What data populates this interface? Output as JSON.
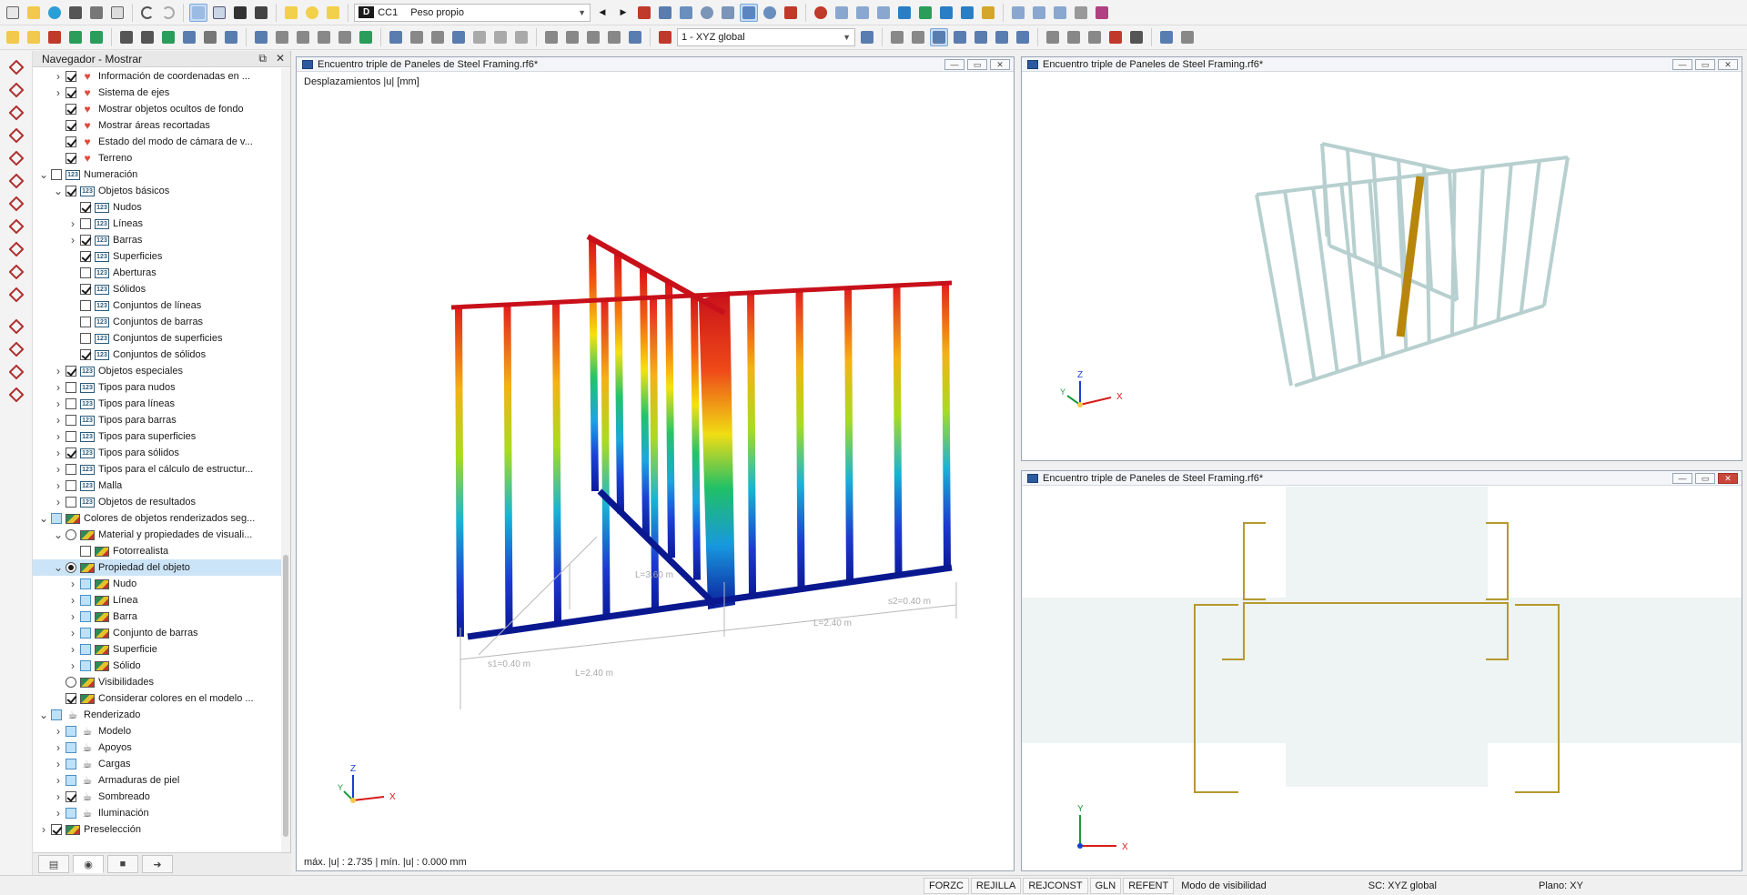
{
  "toolbar": {
    "load_case_badge": "D",
    "load_case_id": "CC1",
    "load_case_name": "Peso propio",
    "coordinate_system": "1 - XYZ global"
  },
  "navigator": {
    "title": "Navegador - Mostrar",
    "items": [
      {
        "indent": 1,
        "twisty": ">",
        "ctl": "cb",
        "checked": true,
        "icon": "heart",
        "label": "Información de coordenadas en ..."
      },
      {
        "indent": 1,
        "twisty": ">",
        "ctl": "cb",
        "checked": true,
        "icon": "heart",
        "label": "Sistema de ejes"
      },
      {
        "indent": 1,
        "twisty": "",
        "ctl": "cb",
        "checked": true,
        "icon": "heart",
        "label": "Mostrar objetos ocultos de fondo"
      },
      {
        "indent": 1,
        "twisty": "",
        "ctl": "cb",
        "checked": true,
        "icon": "heart",
        "label": "Mostrar áreas recortadas"
      },
      {
        "indent": 1,
        "twisty": "",
        "ctl": "cb",
        "checked": true,
        "icon": "heart",
        "label": "Estado del modo de cámara de v..."
      },
      {
        "indent": 1,
        "twisty": "",
        "ctl": "cb",
        "checked": true,
        "icon": "heart",
        "label": "Terreno"
      },
      {
        "indent": 0,
        "twisty": "v",
        "ctl": "cb",
        "checked": false,
        "icon": "num",
        "label": "Numeración"
      },
      {
        "indent": 1,
        "twisty": "v",
        "ctl": "cb",
        "checked": true,
        "icon": "num",
        "label": "Objetos básicos"
      },
      {
        "indent": 2,
        "twisty": "",
        "ctl": "cb",
        "checked": true,
        "icon": "num",
        "label": "Nudos"
      },
      {
        "indent": 2,
        "twisty": ">",
        "ctl": "cb",
        "checked": false,
        "icon": "num",
        "label": "Líneas"
      },
      {
        "indent": 2,
        "twisty": ">",
        "ctl": "cb",
        "checked": true,
        "icon": "num",
        "label": "Barras"
      },
      {
        "indent": 2,
        "twisty": "",
        "ctl": "cb",
        "checked": true,
        "icon": "num",
        "label": "Superficies"
      },
      {
        "indent": 2,
        "twisty": "",
        "ctl": "cb",
        "checked": false,
        "icon": "num",
        "label": "Aberturas"
      },
      {
        "indent": 2,
        "twisty": "",
        "ctl": "cb",
        "checked": true,
        "icon": "num",
        "label": "Sólidos"
      },
      {
        "indent": 2,
        "twisty": "",
        "ctl": "cb",
        "checked": false,
        "icon": "num",
        "label": "Conjuntos de líneas"
      },
      {
        "indent": 2,
        "twisty": "",
        "ctl": "cb",
        "checked": false,
        "icon": "num",
        "label": "Conjuntos de barras"
      },
      {
        "indent": 2,
        "twisty": "",
        "ctl": "cb",
        "checked": false,
        "icon": "num",
        "label": "Conjuntos de superficies"
      },
      {
        "indent": 2,
        "twisty": "",
        "ctl": "cb",
        "checked": true,
        "icon": "num",
        "label": "Conjuntos de sólidos"
      },
      {
        "indent": 1,
        "twisty": ">",
        "ctl": "cb",
        "checked": true,
        "icon": "num",
        "label": "Objetos especiales"
      },
      {
        "indent": 1,
        "twisty": ">",
        "ctl": "cb",
        "checked": false,
        "icon": "num",
        "label": "Tipos para nudos"
      },
      {
        "indent": 1,
        "twisty": ">",
        "ctl": "cb",
        "checked": false,
        "icon": "num",
        "label": "Tipos para líneas"
      },
      {
        "indent": 1,
        "twisty": ">",
        "ctl": "cb",
        "checked": false,
        "icon": "num",
        "label": "Tipos para barras"
      },
      {
        "indent": 1,
        "twisty": ">",
        "ctl": "cb",
        "checked": false,
        "icon": "num",
        "label": "Tipos para superficies"
      },
      {
        "indent": 1,
        "twisty": ">",
        "ctl": "cb",
        "checked": true,
        "icon": "num",
        "label": "Tipos para sólidos"
      },
      {
        "indent": 1,
        "twisty": ">",
        "ctl": "cb",
        "checked": false,
        "icon": "num",
        "label": "Tipos para el cálculo de estructur..."
      },
      {
        "indent": 1,
        "twisty": ">",
        "ctl": "cb",
        "checked": false,
        "icon": "num",
        "label": "Malla"
      },
      {
        "indent": 1,
        "twisty": ">",
        "ctl": "cb",
        "checked": false,
        "icon": "num",
        "label": "Objetos de resultados"
      },
      {
        "indent": 0,
        "twisty": "v",
        "ctl": "cbblue",
        "checked": false,
        "icon": "color",
        "label": "Colores de objetos renderizados seg..."
      },
      {
        "indent": 1,
        "twisty": "v",
        "ctl": "rb",
        "checked": false,
        "icon": "color",
        "label": "Material y propiedades de visuali..."
      },
      {
        "indent": 2,
        "twisty": "",
        "ctl": "cb",
        "checked": false,
        "icon": "color",
        "label": "Fotorrealista"
      },
      {
        "indent": 1,
        "twisty": "v",
        "ctl": "rb",
        "checked": true,
        "icon": "color",
        "label": "Propiedad del objeto",
        "selected": true
      },
      {
        "indent": 2,
        "twisty": ">",
        "ctl": "cbblue",
        "checked": false,
        "icon": "color",
        "label": "Nudo"
      },
      {
        "indent": 2,
        "twisty": ">",
        "ctl": "cbblue",
        "checked": false,
        "icon": "color",
        "label": "Línea"
      },
      {
        "indent": 2,
        "twisty": ">",
        "ctl": "cbblue",
        "checked": false,
        "icon": "color",
        "label": "Barra"
      },
      {
        "indent": 2,
        "twisty": ">",
        "ctl": "cbblue",
        "checked": false,
        "icon": "color",
        "label": "Conjunto de barras"
      },
      {
        "indent": 2,
        "twisty": ">",
        "ctl": "cbblue",
        "checked": false,
        "icon": "color",
        "label": "Superficie"
      },
      {
        "indent": 2,
        "twisty": ">",
        "ctl": "cbblue",
        "checked": false,
        "icon": "color",
        "label": "Sólido"
      },
      {
        "indent": 1,
        "twisty": "",
        "ctl": "rb",
        "checked": false,
        "icon": "color",
        "label": "Visibilidades"
      },
      {
        "indent": 1,
        "twisty": "",
        "ctl": "cb",
        "checked": true,
        "icon": "color",
        "label": "Considerar colores en el modelo ..."
      },
      {
        "indent": 0,
        "twisty": "v",
        "ctl": "cbblue",
        "checked": false,
        "icon": "teapot",
        "label": "Renderizado"
      },
      {
        "indent": 1,
        "twisty": ">",
        "ctl": "cbblue",
        "checked": false,
        "icon": "teapot",
        "label": "Modelo"
      },
      {
        "indent": 1,
        "twisty": ">",
        "ctl": "cbblue",
        "checked": false,
        "icon": "teapot",
        "label": "Apoyos"
      },
      {
        "indent": 1,
        "twisty": ">",
        "ctl": "cbblue",
        "checked": false,
        "icon": "teapot",
        "label": "Cargas"
      },
      {
        "indent": 1,
        "twisty": ">",
        "ctl": "cbblue",
        "checked": false,
        "icon": "teapot",
        "label": "Armaduras de piel"
      },
      {
        "indent": 1,
        "twisty": ">",
        "ctl": "cb",
        "checked": true,
        "icon": "teapot",
        "label": "Sombreado"
      },
      {
        "indent": 1,
        "twisty": ">",
        "ctl": "cbblue",
        "checked": false,
        "icon": "teapot",
        "label": "Iluminación"
      },
      {
        "indent": 0,
        "twisty": ">",
        "ctl": "cb",
        "checked": true,
        "icon": "color",
        "label": "Preselección"
      }
    ]
  },
  "views": {
    "main": {
      "title": "Encuentro triple de Paneles de Steel Framing.rf6*",
      "result_label": "Desplazamientos |u| [mm]",
      "summary": "máx. |u| : 2.735 | mín. |u| : 0.000 mm",
      "dimensions": [
        "L=3.60 m",
        "s2=0.40 m",
        "L=2.40 m",
        "s1=0.40 m",
        "L=2.40 m"
      ]
    },
    "top_right": {
      "title": "Encuentro triple de Paneles de Steel Framing.rf6*"
    },
    "bottom_right": {
      "title": "Encuentro triple de Paneles de Steel Framing.rf6*"
    },
    "axes": {
      "x": "X",
      "y": "Y",
      "z": "Z"
    }
  },
  "status": {
    "toggles": [
      "FORZC",
      "REJILLA",
      "REJCONST",
      "GLN",
      "REFENT"
    ],
    "mode": "Modo de visibilidad",
    "cs": "SC: XYZ global",
    "plane": "Plano: XY"
  },
  "colors": {
    "accent": "#2c5aa0",
    "stud_highlight": "#b8860b",
    "section_outline": "#b59a2e",
    "frame_grey": "#b7cfcf"
  }
}
